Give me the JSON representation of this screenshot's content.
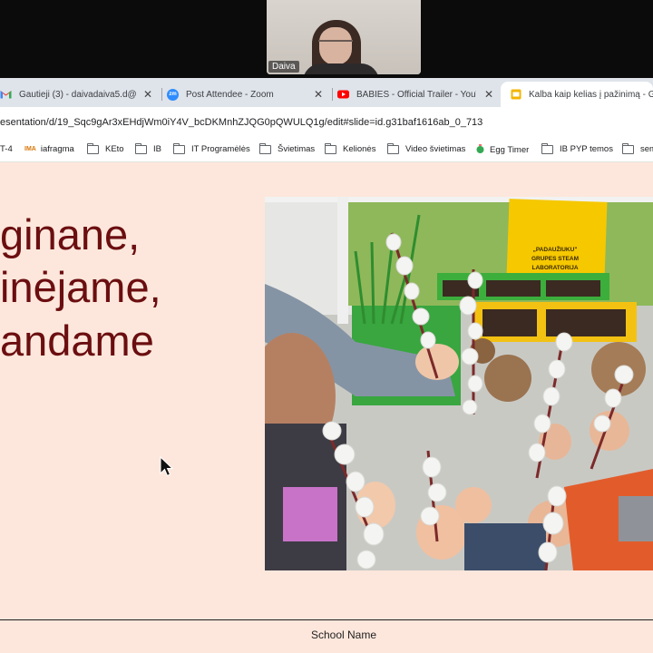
{
  "zoom": {
    "participant_name": "Daiva"
  },
  "tabs": [
    {
      "label": "Gautieji (3) - daivadaiva5.d@gm",
      "icon": "gmail-icon",
      "close": "✕"
    },
    {
      "label": "Post Attendee - Zoom",
      "icon": "zoom-icon",
      "favicon_text": "zm",
      "close": "✕"
    },
    {
      "label": "BABIES - Official Trailer - YouTu",
      "icon": "youtube-icon",
      "close": "✕"
    },
    {
      "label": "Kalba kaip kelias į pažinimą - G",
      "icon": "slides-icon"
    }
  ],
  "address": {
    "url": "esentation/d/19_Sqc9gAr3xEHdjWm0iY4V_bcDKMnhZJQG0pQWULQ1g/edit#slide=id.g31baf1616ab_0_713"
  },
  "bookmarks": [
    {
      "label": "T-4",
      "icon": "none"
    },
    {
      "label": "iafragma",
      "icon": "ima-icon",
      "favicon_text": "IMA"
    },
    {
      "label": "KEto",
      "icon": "folder-icon"
    },
    {
      "label": "IB",
      "icon": "folder-icon"
    },
    {
      "label": "IT Programėlės",
      "icon": "folder-icon"
    },
    {
      "label": "Švietimas",
      "icon": "folder-icon"
    },
    {
      "label": "Kelionės",
      "icon": "folder-icon"
    },
    {
      "label": "Video švietimas",
      "icon": "folder-icon"
    },
    {
      "label": "Egg Timer",
      "icon": "egg-timer-icon"
    },
    {
      "label": "IB PYP temos",
      "icon": "folder-icon"
    },
    {
      "label": "sem",
      "icon": "folder-icon"
    }
  ],
  "slide": {
    "title_lines": [
      "ginane,",
      "inėjame,",
      "andame"
    ],
    "photo_sign_lines": [
      "„PADAUŽIUKU\"",
      "GRUPES STEAM",
      "LABORATORIJA"
    ],
    "footer": "School Name"
  },
  "colors": {
    "slide_background": "#fde7dc",
    "title_color": "#6b0e10",
    "tab_bar": "#dfe3ea"
  }
}
